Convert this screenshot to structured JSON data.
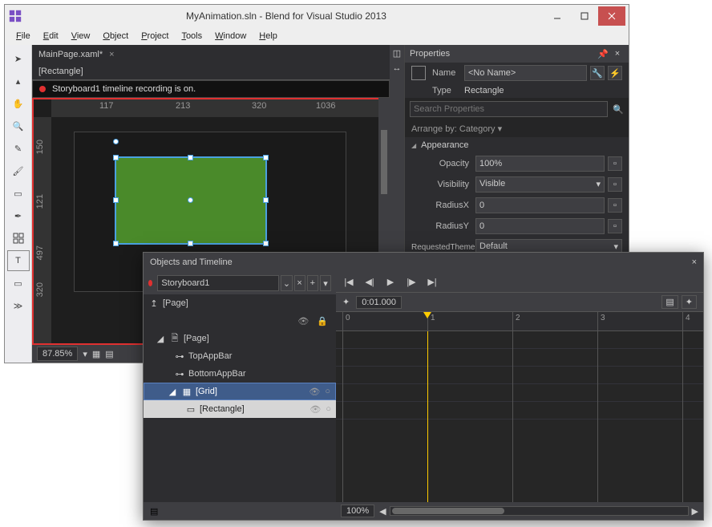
{
  "main_window": {
    "title": "MyAnimation.sln - Blend for Visual Studio 2013",
    "menu": [
      "File",
      "Edit",
      "View",
      "Object",
      "Project",
      "Tools",
      "Window",
      "Help"
    ],
    "tab": "MainPage.xaml*",
    "breadcrumb": "[Rectangle]",
    "record_status": "Storyboard1 timeline recording is on.",
    "ruler_h": {
      "a": "117",
      "b": "213",
      "c": "1036",
      "d": "320"
    },
    "ruler_v": {
      "a": "150",
      "b": "121",
      "c": "497",
      "d": "320"
    },
    "zoom": "87.85%"
  },
  "properties": {
    "header": "Properties",
    "name_label": "Name",
    "name_value": "<No Name>",
    "type_label": "Type",
    "type_value": "Rectangle",
    "search_placeholder": "Search Properties",
    "arrange_by": "Arrange by: Category ▾",
    "section": "Appearance",
    "rows": {
      "opacity": {
        "label": "Opacity",
        "value": "100%"
      },
      "visibility": {
        "label": "Visibility",
        "value": "Visible"
      },
      "radiusx": {
        "label": "RadiusX",
        "value": "0"
      },
      "radiusy": {
        "label": "RadiusY",
        "value": "0"
      },
      "theme": {
        "label": "RequestedTheme",
        "value": "Default"
      }
    }
  },
  "timeline": {
    "header": "Objects and Timeline",
    "storyboard": "Storyboard1",
    "scope": "[Page]",
    "tree": {
      "page": "[Page]",
      "top": "TopAppBar",
      "bottom": "BottomAppBar",
      "grid": "[Grid]",
      "rect": "[Rectangle]"
    },
    "time": "0:01.000",
    "ticks": [
      "0",
      "1",
      "2",
      "3",
      "4"
    ],
    "zoom": "100%"
  }
}
